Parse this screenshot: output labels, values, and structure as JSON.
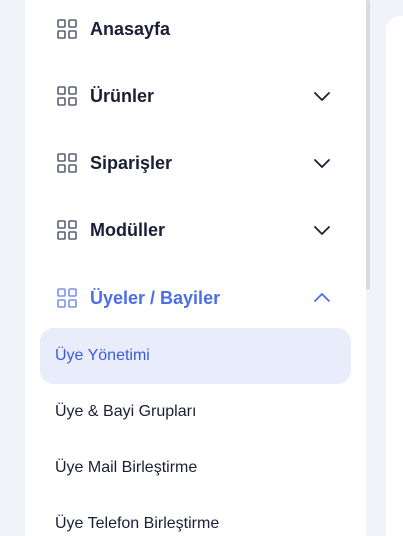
{
  "menu": {
    "items": [
      {
        "label": "Anasayfa",
        "icon": "grid-icon",
        "expandable": false
      },
      {
        "label": "Ürünler",
        "icon": "grid-icon",
        "expandable": true,
        "expanded": false
      },
      {
        "label": "Siparişler",
        "icon": "grid-icon",
        "expandable": true,
        "expanded": false
      },
      {
        "label": "Modüller",
        "icon": "grid-icon",
        "expandable": true,
        "expanded": false
      },
      {
        "label": "Üyeler / Bayiler",
        "icon": "grid-icon",
        "expandable": true,
        "expanded": true
      }
    ],
    "submenu": [
      {
        "label": "Üye Yönetimi",
        "selected": true
      },
      {
        "label": "Üye & Bayi Grupları",
        "selected": false
      },
      {
        "label": "Üye Mail Birleştirme",
        "selected": false
      },
      {
        "label": "Üye Telefon Birleştirme",
        "selected": false
      }
    ]
  },
  "colors": {
    "accent": "#4c6fe8",
    "text": "#1a1f36",
    "selected_bg": "#e8ecfb",
    "icon": "#5a5f73"
  }
}
